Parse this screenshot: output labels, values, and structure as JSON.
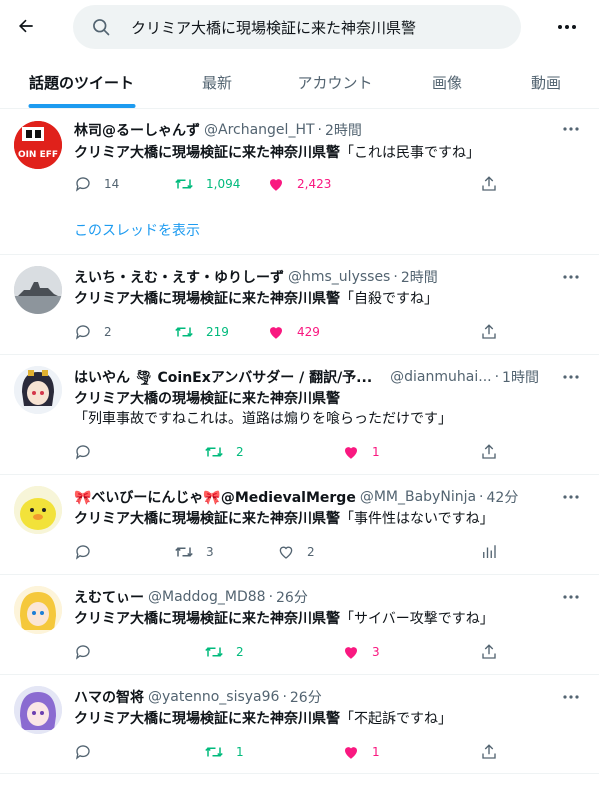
{
  "search": {
    "query": "クリミア大橋に現場検証に来た神奈川県警"
  },
  "tabs": [
    {
      "label": "話題のツイート"
    },
    {
      "label": "最新"
    },
    {
      "label": "アカウント"
    },
    {
      "label": "画像"
    },
    {
      "label": "動画"
    }
  ],
  "tweets": [
    {
      "name": "林司@るーしゃんず",
      "handle": "@Archangel_HT",
      "time": "2時間",
      "text_bold": "クリミア大橋に現場検証に来た神奈川県警",
      "text_rest": "「これは民事ですね」",
      "replies": "14",
      "retweets": "1,094",
      "likes": "2,423",
      "liked": true,
      "thread_link": "このスレッドを表示"
    },
    {
      "name": "えいち・えむ・えす・ゆりしーず",
      "handle": "@hms_ulysses",
      "time": "2時間",
      "text_bold": "クリミア大橋に現場検証に来た神奈川県警",
      "text_rest": "「自殺ですね」",
      "replies": "2",
      "retweets": "219",
      "likes": "429",
      "liked": true
    },
    {
      "name": "はいやん 🌪 CoinExアンバサダー / 翻訳/予...",
      "handle": "@dianmuhai...",
      "time": "1時間",
      "text_bold": "クリミア大橋",
      "text_rest": "の現場検証に来た神奈川県警",
      "text_line2": "「列車事故ですねこれは。道路は煽りを喰らっただけです」",
      "replies": "",
      "retweets": "2",
      "likes": "1",
      "liked": true
    },
    {
      "name": "🎀べいびーにんじゃ🎀@MedievalMerge",
      "handle": "@MM_BabyNinja",
      "time": "42分",
      "text_bold": "クリミア大橋に現場検証に来た神奈川県警",
      "text_rest": "「事件性はないですね」",
      "replies": "",
      "retweets": "3",
      "likes": "2",
      "liked": false
    },
    {
      "name": "えむてぃー",
      "handle": "@Maddog_MD88",
      "time": "26分",
      "text_bold": "クリミア大橋に現場検証に来た神奈川県警",
      "text_rest": "「サイバー攻撃ですね」",
      "replies": "",
      "retweets": "2",
      "likes": "3",
      "liked": true
    },
    {
      "name": "ハマの智将",
      "handle": "@yatenno_sisya96",
      "time": "26分",
      "text_bold": "クリミア大橋に現場検証に来た神奈川県警",
      "text_rest": "「不起訴ですね」",
      "replies": "",
      "retweets": "1",
      "likes": "1",
      "liked": true
    }
  ],
  "avatar1_text": "OIN EFF",
  "colors": {
    "accent": "#1d9bf0",
    "retweet": "#00ba7c",
    "like": "#f91880",
    "muted": "#536471"
  }
}
